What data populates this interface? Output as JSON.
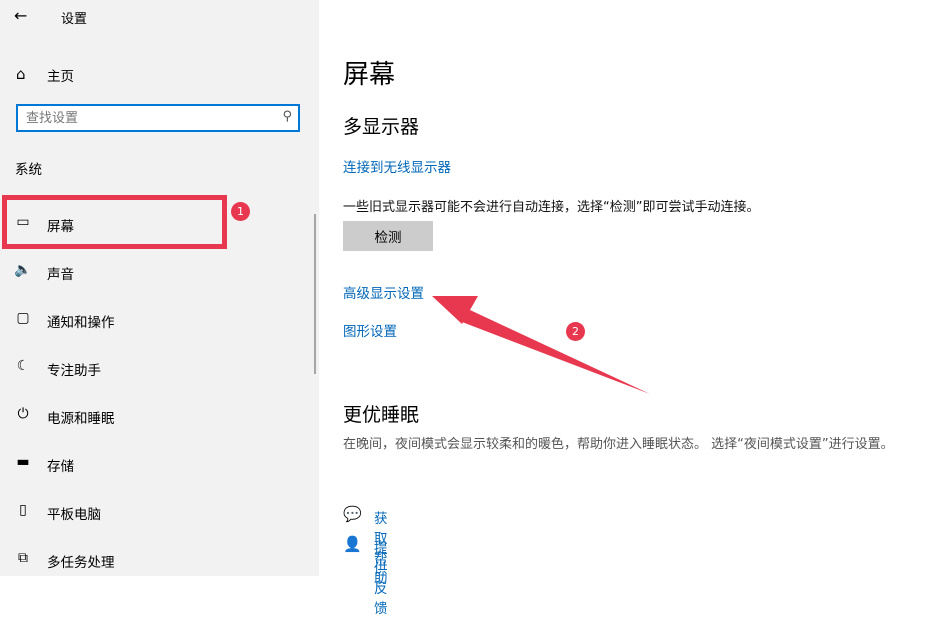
{
  "window": {
    "back": "←",
    "title": "设置"
  },
  "sidebar": {
    "home": {
      "icon": "⌂",
      "label": "主页"
    },
    "search": {
      "placeholder": "查找设置",
      "icon": "⚲"
    },
    "section": "系统",
    "items": [
      {
        "icon": "▭",
        "label": "屏幕",
        "icon_name": "monitor-icon"
      },
      {
        "icon": "🔈",
        "label": "声音",
        "icon_name": "speaker-icon"
      },
      {
        "icon": "▢",
        "label": "通知和操作",
        "icon_name": "notification-icon"
      },
      {
        "icon": "☾",
        "label": "专注助手",
        "icon_name": "moon-icon"
      },
      {
        "icon": "⏻",
        "label": "电源和睡眠",
        "icon_name": "power-icon"
      },
      {
        "icon": "▬",
        "label": "存储",
        "icon_name": "storage-icon"
      },
      {
        "icon": "▯",
        "label": "平板电脑",
        "icon_name": "tablet-icon"
      },
      {
        "icon": "⧉",
        "label": "多任务处理",
        "icon_name": "multitask-icon"
      }
    ]
  },
  "main": {
    "title": "屏幕",
    "multi_display": {
      "heading": "多显示器",
      "wireless_link": "连接到无线显示器",
      "description": "一些旧式显示器可能不会进行自动连接，选择“检测”即可尝试手动连接。",
      "detect_button": "检测",
      "advanced_link": "高级显示设置",
      "graphics_link": "图形设置"
    },
    "sleep": {
      "heading": "更优睡眠",
      "description": "在晚间，夜间模式会显示较柔和的暖色，帮助你进入睡眠状态。 选择“夜间模式设置”进行设置。"
    },
    "help": {
      "icon": "💬",
      "label": "获取帮助"
    },
    "feedback": {
      "icon": "👤",
      "label": "提供反馈"
    }
  },
  "annotations": {
    "badge1": "1",
    "badge2": "2",
    "color": "#e8384f"
  }
}
